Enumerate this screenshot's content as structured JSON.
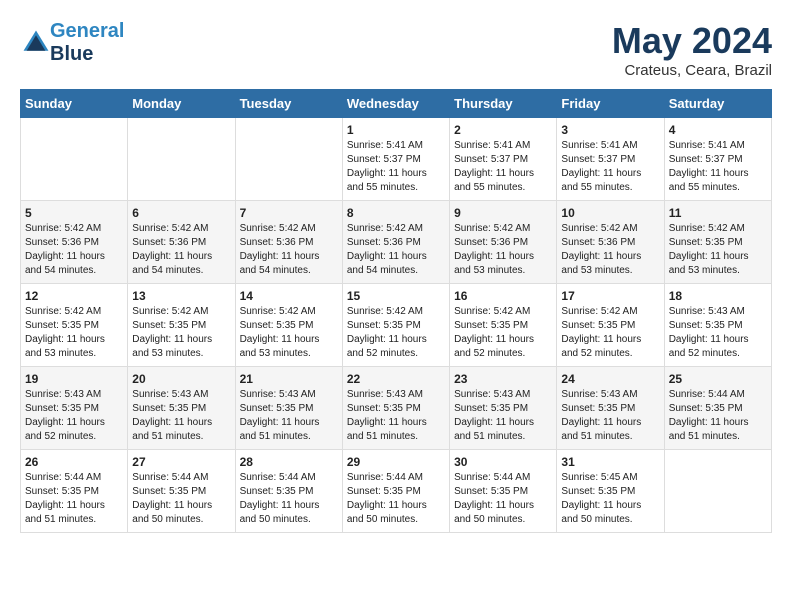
{
  "header": {
    "logo_line1": "General",
    "logo_line2": "Blue",
    "month_title": "May 2024",
    "location": "Crateus, Ceara, Brazil"
  },
  "days_of_week": [
    "Sunday",
    "Monday",
    "Tuesday",
    "Wednesday",
    "Thursday",
    "Friday",
    "Saturday"
  ],
  "weeks": [
    [
      {
        "day": "",
        "info": ""
      },
      {
        "day": "",
        "info": ""
      },
      {
        "day": "",
        "info": ""
      },
      {
        "day": "1",
        "info": "Sunrise: 5:41 AM\nSunset: 5:37 PM\nDaylight: 11 hours\nand 55 minutes."
      },
      {
        "day": "2",
        "info": "Sunrise: 5:41 AM\nSunset: 5:37 PM\nDaylight: 11 hours\nand 55 minutes."
      },
      {
        "day": "3",
        "info": "Sunrise: 5:41 AM\nSunset: 5:37 PM\nDaylight: 11 hours\nand 55 minutes."
      },
      {
        "day": "4",
        "info": "Sunrise: 5:41 AM\nSunset: 5:37 PM\nDaylight: 11 hours\nand 55 minutes."
      }
    ],
    [
      {
        "day": "5",
        "info": "Sunrise: 5:42 AM\nSunset: 5:36 PM\nDaylight: 11 hours\nand 54 minutes."
      },
      {
        "day": "6",
        "info": "Sunrise: 5:42 AM\nSunset: 5:36 PM\nDaylight: 11 hours\nand 54 minutes."
      },
      {
        "day": "7",
        "info": "Sunrise: 5:42 AM\nSunset: 5:36 PM\nDaylight: 11 hours\nand 54 minutes."
      },
      {
        "day": "8",
        "info": "Sunrise: 5:42 AM\nSunset: 5:36 PM\nDaylight: 11 hours\nand 54 minutes."
      },
      {
        "day": "9",
        "info": "Sunrise: 5:42 AM\nSunset: 5:36 PM\nDaylight: 11 hours\nand 53 minutes."
      },
      {
        "day": "10",
        "info": "Sunrise: 5:42 AM\nSunset: 5:36 PM\nDaylight: 11 hours\nand 53 minutes."
      },
      {
        "day": "11",
        "info": "Sunrise: 5:42 AM\nSunset: 5:35 PM\nDaylight: 11 hours\nand 53 minutes."
      }
    ],
    [
      {
        "day": "12",
        "info": "Sunrise: 5:42 AM\nSunset: 5:35 PM\nDaylight: 11 hours\nand 53 minutes."
      },
      {
        "day": "13",
        "info": "Sunrise: 5:42 AM\nSunset: 5:35 PM\nDaylight: 11 hours\nand 53 minutes."
      },
      {
        "day": "14",
        "info": "Sunrise: 5:42 AM\nSunset: 5:35 PM\nDaylight: 11 hours\nand 53 minutes."
      },
      {
        "day": "15",
        "info": "Sunrise: 5:42 AM\nSunset: 5:35 PM\nDaylight: 11 hours\nand 52 minutes."
      },
      {
        "day": "16",
        "info": "Sunrise: 5:42 AM\nSunset: 5:35 PM\nDaylight: 11 hours\nand 52 minutes."
      },
      {
        "day": "17",
        "info": "Sunrise: 5:42 AM\nSunset: 5:35 PM\nDaylight: 11 hours\nand 52 minutes."
      },
      {
        "day": "18",
        "info": "Sunrise: 5:43 AM\nSunset: 5:35 PM\nDaylight: 11 hours\nand 52 minutes."
      }
    ],
    [
      {
        "day": "19",
        "info": "Sunrise: 5:43 AM\nSunset: 5:35 PM\nDaylight: 11 hours\nand 52 minutes."
      },
      {
        "day": "20",
        "info": "Sunrise: 5:43 AM\nSunset: 5:35 PM\nDaylight: 11 hours\nand 51 minutes."
      },
      {
        "day": "21",
        "info": "Sunrise: 5:43 AM\nSunset: 5:35 PM\nDaylight: 11 hours\nand 51 minutes."
      },
      {
        "day": "22",
        "info": "Sunrise: 5:43 AM\nSunset: 5:35 PM\nDaylight: 11 hours\nand 51 minutes."
      },
      {
        "day": "23",
        "info": "Sunrise: 5:43 AM\nSunset: 5:35 PM\nDaylight: 11 hours\nand 51 minutes."
      },
      {
        "day": "24",
        "info": "Sunrise: 5:43 AM\nSunset: 5:35 PM\nDaylight: 11 hours\nand 51 minutes."
      },
      {
        "day": "25",
        "info": "Sunrise: 5:44 AM\nSunset: 5:35 PM\nDaylight: 11 hours\nand 51 minutes."
      }
    ],
    [
      {
        "day": "26",
        "info": "Sunrise: 5:44 AM\nSunset: 5:35 PM\nDaylight: 11 hours\nand 51 minutes."
      },
      {
        "day": "27",
        "info": "Sunrise: 5:44 AM\nSunset: 5:35 PM\nDaylight: 11 hours\nand 50 minutes."
      },
      {
        "day": "28",
        "info": "Sunrise: 5:44 AM\nSunset: 5:35 PM\nDaylight: 11 hours\nand 50 minutes."
      },
      {
        "day": "29",
        "info": "Sunrise: 5:44 AM\nSunset: 5:35 PM\nDaylight: 11 hours\nand 50 minutes."
      },
      {
        "day": "30",
        "info": "Sunrise: 5:44 AM\nSunset: 5:35 PM\nDaylight: 11 hours\nand 50 minutes."
      },
      {
        "day": "31",
        "info": "Sunrise: 5:45 AM\nSunset: 5:35 PM\nDaylight: 11 hours\nand 50 minutes."
      },
      {
        "day": "",
        "info": ""
      }
    ]
  ]
}
